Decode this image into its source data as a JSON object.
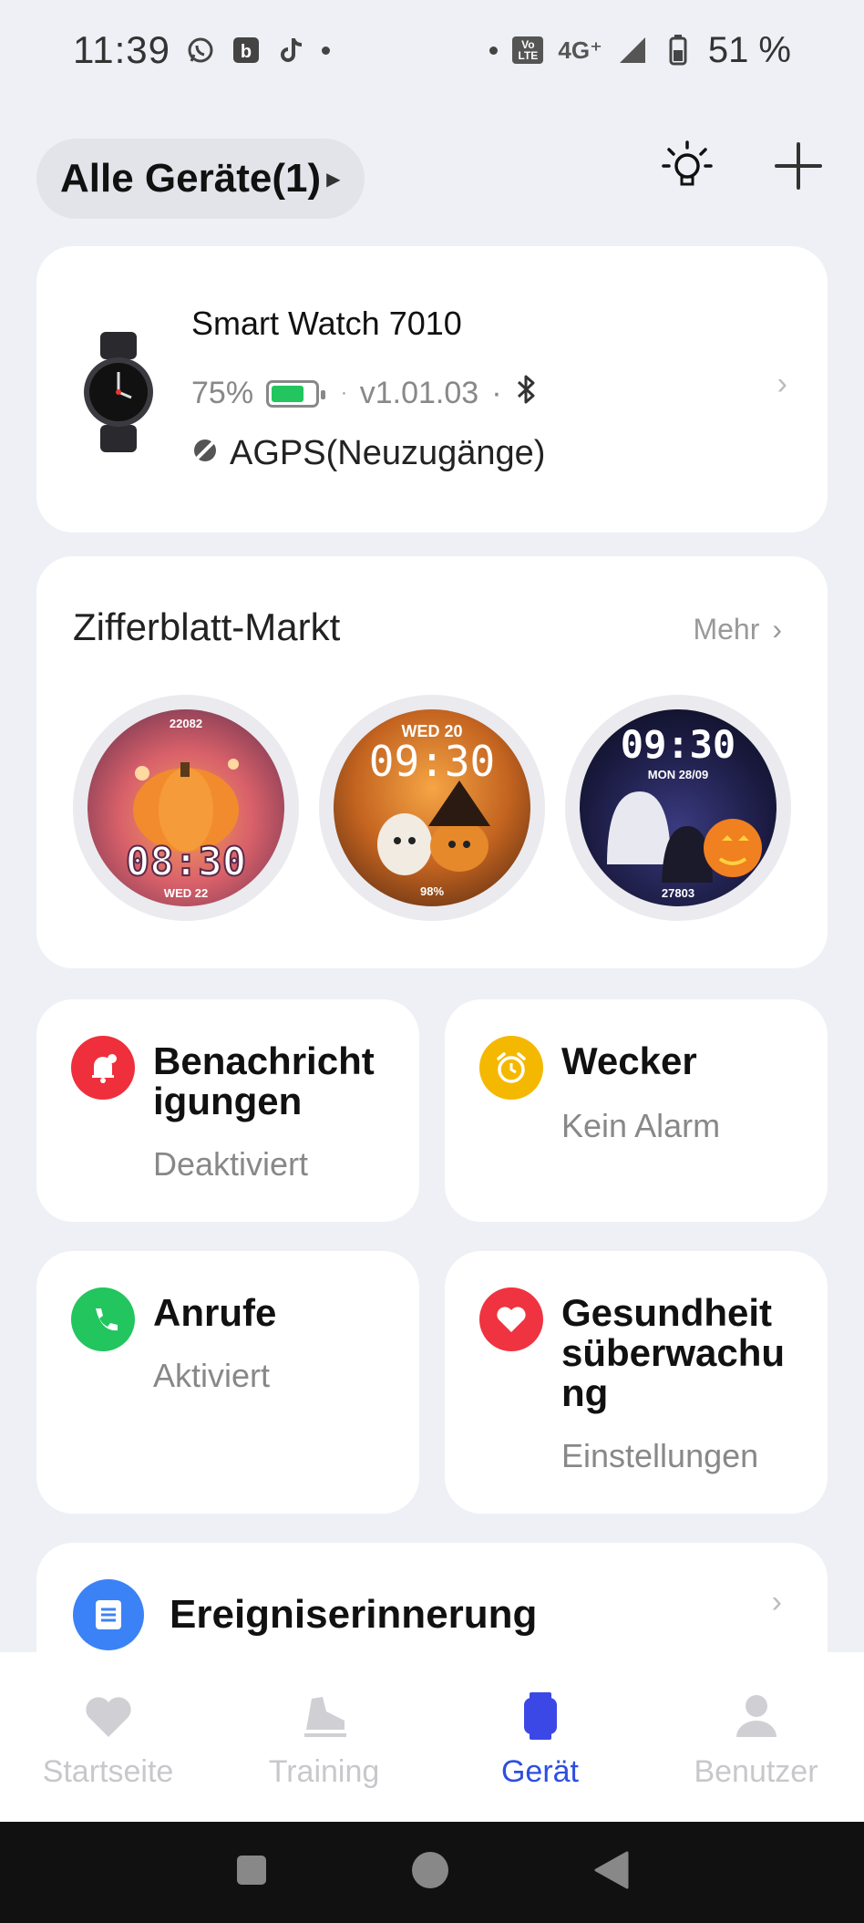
{
  "status_bar": {
    "time": "11:39",
    "network": "4G⁺",
    "volte": "Vo LTE",
    "battery": "51 %",
    "app_icons": [
      "whatsapp-icon",
      "b-app-icon",
      "tiktok-icon"
    ]
  },
  "header": {
    "device_selector": "Alle Geräte(1)",
    "icons": [
      "lightbulb-icon",
      "plus-icon"
    ]
  },
  "watch": {
    "name": "Smart Watch 7010",
    "battery_pct": "75%",
    "battery_level": 0.75,
    "version": "v1.01.03",
    "separator": "·",
    "agps": "AGPS(Neuzugänge)"
  },
  "market": {
    "title": "Zifferblatt-Markt",
    "more": "Mehr",
    "faces": [
      {
        "top": "22082",
        "time": "08:30",
        "bottom": "WED 22"
      },
      {
        "top": "WED 20",
        "time": "09:30",
        "bottom": "98%"
      },
      {
        "top": "09:30",
        "time": "",
        "bottom": "MON 28/09",
        "steps": "27803"
      }
    ]
  },
  "tiles": {
    "notifications": {
      "title": "Benachricht igungen",
      "sub": "Deaktiviert"
    },
    "alarm": {
      "title": "Wecker",
      "sub": "Kein Alarm"
    },
    "calls": {
      "title": "Anrufe",
      "sub": "Aktiviert"
    },
    "health": {
      "title": "Gesundheit süberwachu ng",
      "sub": "Einstellungen"
    }
  },
  "event": {
    "title": "Ereigniserinnerung"
  },
  "bottom_nav": [
    {
      "label": "Startseite",
      "icon": "heart-icon",
      "active": false
    },
    {
      "label": "Training",
      "icon": "shoe-icon",
      "active": false
    },
    {
      "label": "Gerät",
      "icon": "watch-icon",
      "active": true
    },
    {
      "label": "Benutzer",
      "icon": "user-icon",
      "active": false
    }
  ],
  "colors": {
    "accent": "#2d4fe0",
    "notification_red": "#ef2f3c",
    "alarm_yellow": "#f5b800",
    "call_green": "#22c55e",
    "health_red": "#ef3340",
    "event_blue": "#3b82f6",
    "battery_green": "#22c55e"
  }
}
